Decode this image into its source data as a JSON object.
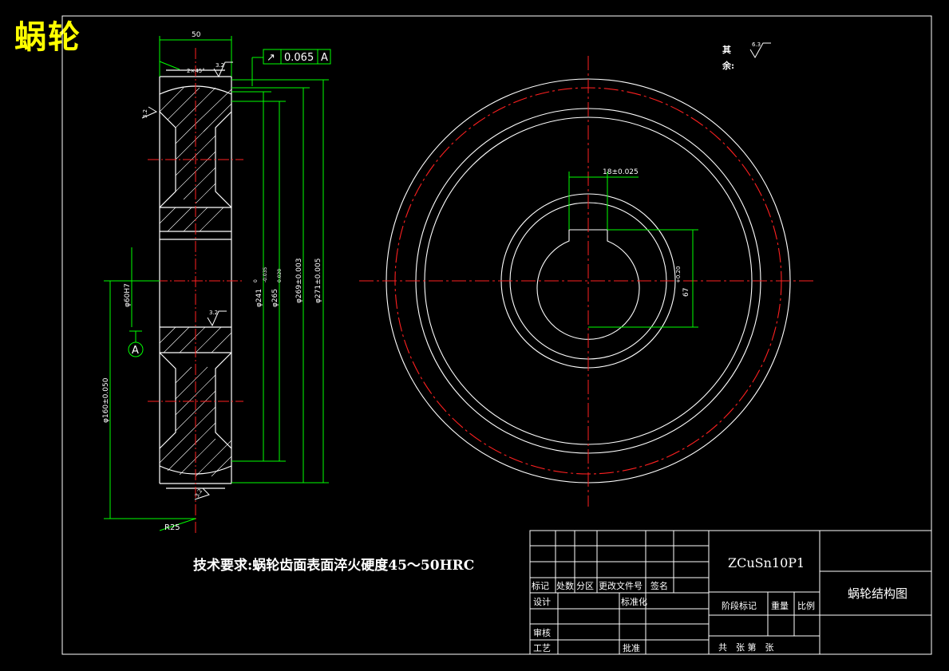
{
  "drawing_title": "蜗轮",
  "tech_requirement": "技术要求:蜗轮齿面表面淬火硬度45～50HRC",
  "roughness_note": {
    "prefix_1": "其",
    "prefix_2": "余:",
    "value": "6.3"
  },
  "dimensions": {
    "width": "50",
    "chamfer": "2×45°",
    "roughness_top": "3.2",
    "roughness_left": "3.2",
    "roughness_bore": "3.2",
    "roughness_bottom": "3.2",
    "runout_tolerance": "0.065",
    "datum": "A",
    "bore_diameter": "φ60H7",
    "hub_diameter": "φ160±0.050",
    "pitch_diameter": "φ241",
    "pitch_tolerance_upper": "0",
    "pitch_tolerance_lower": "-0.035",
    "throat_diameter": "φ265",
    "throat_tolerance": "0.020",
    "outer_diameter_1": "φ269±0.003",
    "outer_diameter_2": "φ271±0.005",
    "radius": "R25",
    "keyway_width": "18±0.025",
    "keyway_depth": "67",
    "keyway_depth_tolerance": "+0.20"
  },
  "title_block": {
    "material": "ZCuSn10P1",
    "drawing_name": "蜗轮结构图",
    "row_labels": [
      "标记",
      "处数",
      "分区",
      "更改文件号",
      "签名"
    ],
    "design": "设计",
    "standardization": "标准化",
    "review": "审核",
    "process": "工艺",
    "approve": "批准",
    "stage_mark": "阶段标记",
    "weight": "重量",
    "scale": "比例",
    "sheets": "共　张 第　张"
  }
}
